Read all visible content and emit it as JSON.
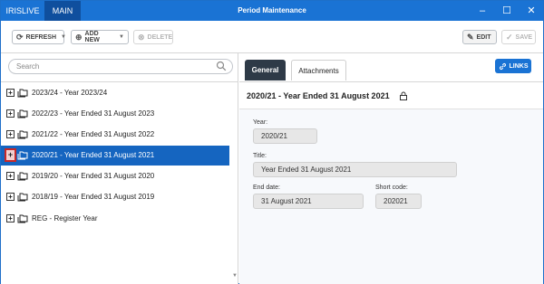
{
  "titlebar": {
    "tab_app": "IRISLIVE",
    "tab_main": "MAIN",
    "title": "Period Maintenance",
    "minimize_glyph": "–",
    "maximize_glyph": "☐",
    "close_glyph": "✕"
  },
  "toolbar": {
    "refresh_label": "REFRESH",
    "add_new_label": "ADD NEW",
    "delete_label": "DELETE",
    "edit_label": "EDIT",
    "save_label": "SAVE"
  },
  "search": {
    "placeholder": "Search"
  },
  "tree": {
    "items": [
      {
        "label": "2023/24 - Year 2023/24"
      },
      {
        "label": "2022/23 - Year Ended 31 August 2023"
      },
      {
        "label": "2021/22 - Year Ended 31 August 2022"
      },
      {
        "label": "2020/21 - Year Ended 31 August 2021",
        "selected": true
      },
      {
        "label": "2019/20 - Year Ended 31 August 2020"
      },
      {
        "label": "2018/19 - Year Ended 31 August 2019"
      },
      {
        "label": "REG - Register Year"
      }
    ],
    "expander_glyph": "+"
  },
  "detail": {
    "tabs": [
      "General",
      "Attachments"
    ],
    "links_label": "LINKS",
    "record_title": "2020/21 - Year Ended 31 August 2021",
    "fields": {
      "year_label": "Year:",
      "year_value": "2020/21",
      "title_label": "Title:",
      "title_value": "Year Ended 31 August 2021",
      "end_date_label": "End date:",
      "end_date_value": "31 August 2021",
      "short_code_label": "Short code:",
      "short_code_value": "202021"
    }
  },
  "colors": {
    "accent": "#1a73d4",
    "selected_row": "#1565c0",
    "active_tab": "#2e3a47",
    "highlight_border": "#c62828"
  }
}
